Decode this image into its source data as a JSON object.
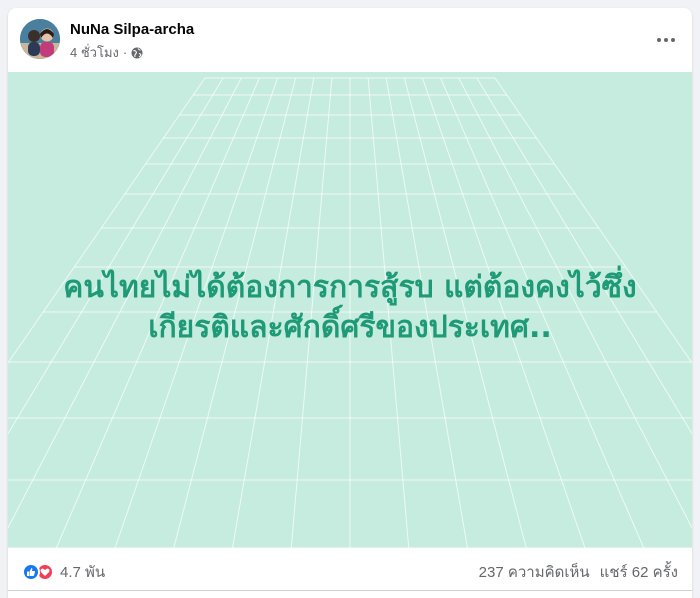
{
  "post": {
    "author": "NuNa Silpa-archa",
    "time": "4 ชั่วโมง",
    "separator": "·",
    "privacy_icon": "globe-icon",
    "more_icon": "more-options-icon",
    "text_lines": [
      "คนไทยไม่ได้ต้องการการสู้รบ แต่ต้องคงไว้ซึ่ง",
      "เกียรติและศักดิ์ศรีของประเทศ.."
    ],
    "background_color": "#c5ecdf",
    "text_color": "#1f9a76"
  },
  "footer": {
    "reaction_icons": [
      "like-icon",
      "love-icon"
    ],
    "reaction_count": "4.7 พัน",
    "comments": "237 ความคิดเห็น",
    "shares": "แชร์ 62 ครั้ง"
  }
}
